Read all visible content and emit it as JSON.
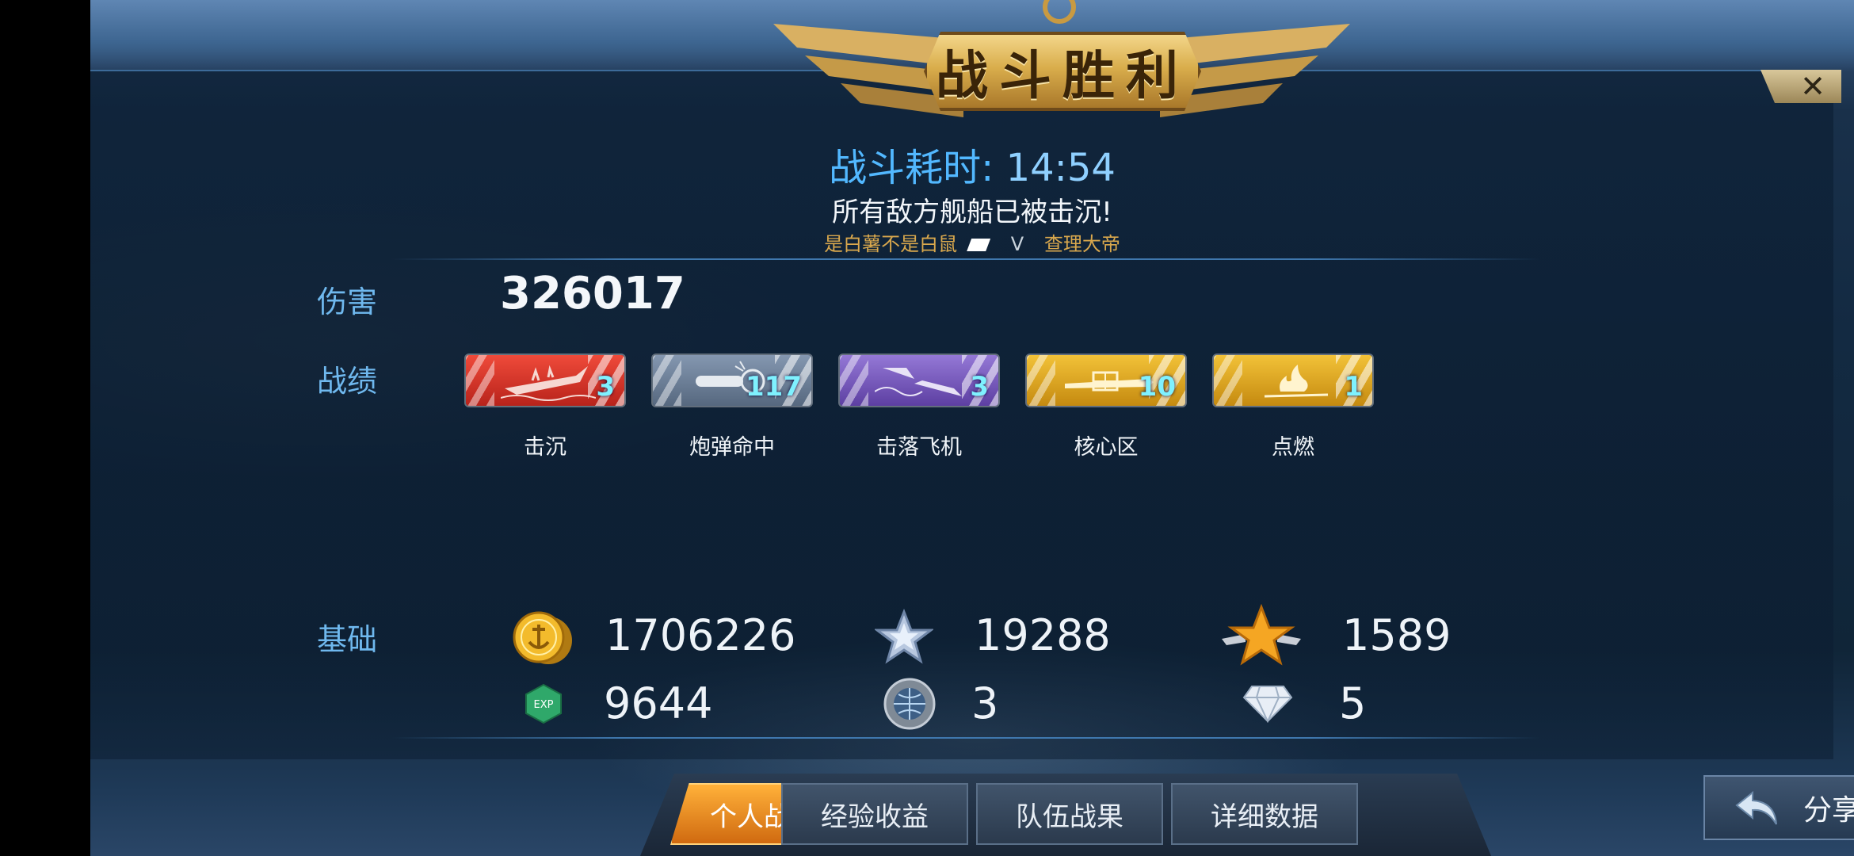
{
  "header": {
    "title": "战斗胜利",
    "close_symbol": "✕"
  },
  "battle": {
    "duration_label": "战斗耗时:",
    "duration_value": "14:54",
    "result_text": "所有敌方舰船已被击沉!",
    "player_left": "是白薯不是白鼠",
    "vs": "V",
    "player_right": "查理大帝"
  },
  "stats": {
    "damage_label": "伤害",
    "damage_value": "326017",
    "record_label": "战绩",
    "medals": [
      {
        "icon": "ship-sink-icon",
        "count": "3",
        "label": "击沉",
        "color": "#d8332a"
      },
      {
        "icon": "shell-hit-icon",
        "count": "117",
        "label": "炮弹命中",
        "color": "#6a7f98"
      },
      {
        "icon": "plane-down-icon",
        "count": "3",
        "label": "击落飞机",
        "color": "#7a5cc0"
      },
      {
        "icon": "citadel-icon",
        "count": "10",
        "label": "核心区",
        "color": "#e0a820"
      },
      {
        "icon": "fire-icon",
        "count": "1",
        "label": "点燃",
        "color": "#e0a820"
      }
    ]
  },
  "base": {
    "label": "基础",
    "items": [
      {
        "icon": "gold-coin-icon",
        "value": "1706226"
      },
      {
        "icon": "silver-star-icon",
        "value": "19288"
      },
      {
        "icon": "gold-star-icon",
        "value": "1589"
      },
      {
        "icon": "exp-icon",
        "value": "9644",
        "icon_text": "EXP"
      },
      {
        "icon": "globe-medal-icon",
        "value": "3"
      },
      {
        "icon": "diamond-icon",
        "value": "5"
      }
    ]
  },
  "tabs": [
    {
      "label": "个人战果",
      "active": true
    },
    {
      "label": "经验收益",
      "active": false
    },
    {
      "label": "队伍战果",
      "active": false
    },
    {
      "label": "详细数据",
      "active": false
    }
  ],
  "share": {
    "label": "分享"
  },
  "colors": {
    "accent_blue": "#52b8ff",
    "gold": "#d9a84d",
    "orange_tab": "#e8891f"
  }
}
